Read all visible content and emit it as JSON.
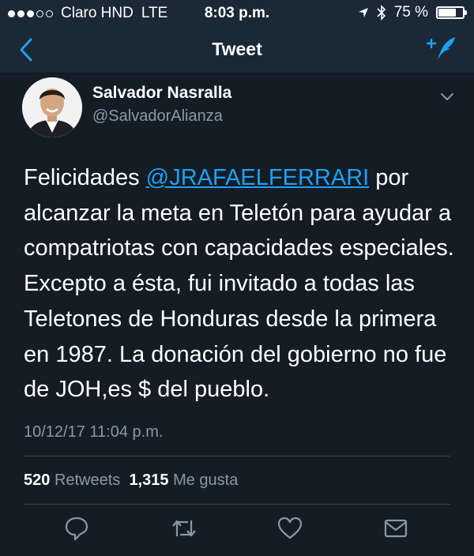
{
  "status_bar": {
    "carrier": "Claro HND",
    "network": "LTE",
    "time": "8:03 p.m.",
    "battery": "75 %",
    "battery_level": 0.75
  },
  "nav": {
    "title": "Tweet",
    "back_icon": "chevron-left-icon",
    "compose_icon": "compose-tweet-icon"
  },
  "tweet": {
    "author_name": "Salvador Nasralla",
    "author_handle": "@SalvadorAlianza",
    "text_before_mention": "Felicidades ",
    "mention": "@JRAFAELFERRARI",
    "text_after_mention": " por alcanzar la meta en Teletón para ayudar a compatriotas con capacidades especiales. Excepto a ésta, fui invitado a todas las Teletones de Honduras desde la primera en 1987. La donación del gobierno no fue de JOH,es $ del pueblo.",
    "timestamp": "10/12/17 11:04 p.m.",
    "retweets_count": "520",
    "retweets_label": "Retweets",
    "likes_count": "1,315",
    "likes_label": "Me gusta"
  },
  "colors": {
    "background": "#141d26",
    "bar": "#1b2836",
    "accent": "#1da1f2",
    "muted": "#8899a6"
  }
}
